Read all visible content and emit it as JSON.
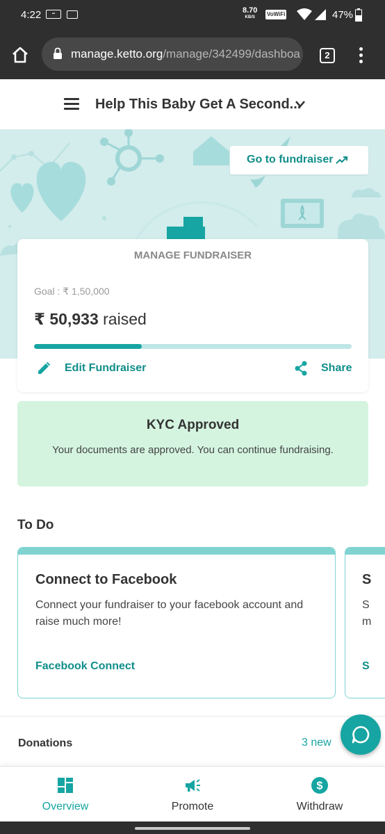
{
  "status_bar": {
    "time": "4:22",
    "net_speed": "8.70",
    "net_speed_unit": "KB/S",
    "vowifi": "VoWiFi",
    "battery": "47%"
  },
  "browser": {
    "url_host": "manage.ketto.org",
    "url_path": "/manage/342499/dashboa",
    "tab_count": "2"
  },
  "header": {
    "title": "Help This Baby Get A Second..."
  },
  "hero": {
    "goto_label": "Go to fundraiser"
  },
  "manage_card": {
    "title": "MANAGE FUNDRAISER",
    "goal": "Goal : ₹ 1,50,000",
    "raised_amount": "₹ 50,933",
    "raised_suffix": "raised",
    "progress_fraction": 0.34,
    "edit_label": "Edit Fundraiser",
    "share_label": "Share"
  },
  "kyc": {
    "title": "KYC Approved",
    "text": "Your documents are approved. You can continue fundraising."
  },
  "todo": {
    "heading": "To Do",
    "cards": [
      {
        "title": "Connect to Facebook",
        "description": "Connect your fundraiser to your facebook account and raise much more!",
        "action": "Facebook Connect"
      },
      {
        "title": "S",
        "description": "S m",
        "action": "S"
      }
    ]
  },
  "donations": {
    "label": "Donations",
    "new_count": "3 new"
  },
  "bottom_nav": {
    "items": [
      {
        "label": "Overview",
        "icon": "dashboard-icon",
        "active": true
      },
      {
        "label": "Promote",
        "icon": "megaphone-icon",
        "active": false
      },
      {
        "label": "Withdraw",
        "icon": "dollar-icon",
        "active": false
      }
    ]
  },
  "colors": {
    "accent": "#16a5a2",
    "accent_dark": "#108e8b",
    "hero_bg": "#d3ecec",
    "kyc_bg": "#d4f4e0",
    "chrome_bg": "#2f2f2f"
  }
}
